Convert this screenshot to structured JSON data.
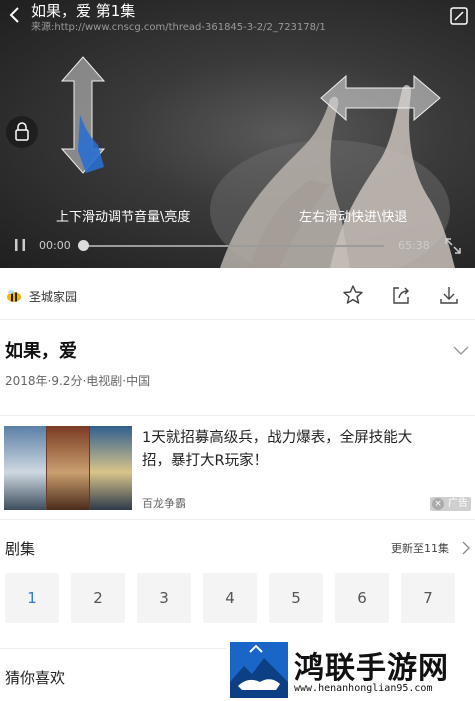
{
  "player": {
    "title": "如果，爱 第1集",
    "source_url": "来源:http://www.cnscg.com/thread-361845-3-2/2_723178/1",
    "hint_left": "上下滑动调节音量\\亮度",
    "hint_right": "左右滑动快进\\快退",
    "current_time": "00:00",
    "total_time": "65:38",
    "progress": 0
  },
  "source": {
    "name": "圣城家园"
  },
  "show": {
    "title": "如果，爱",
    "meta": "2018年·9.2分·电视剧·中国"
  },
  "ad": {
    "text": "1天就招募高级兵，战力爆表，全屏技能大招，暴打大R玩家！",
    "brand": "百龙争霸",
    "badge": "广告"
  },
  "episodes": {
    "heading": "剧集",
    "update": "更新至11集",
    "items": [
      "1",
      "2",
      "3",
      "4",
      "5",
      "6",
      "7"
    ],
    "active": "1"
  },
  "guess": {
    "heading": "猜你喜欢"
  },
  "watermark": {
    "title": "鸿联手游网",
    "url": "www.henanhonglian95.com"
  },
  "colors": {
    "accent": "#2f7bd8",
    "player_bg": "#2a2a2a"
  }
}
